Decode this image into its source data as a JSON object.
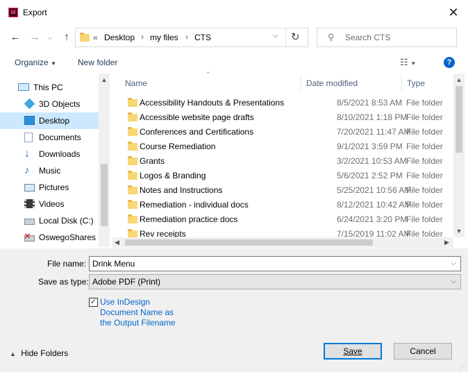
{
  "window": {
    "title": "Export",
    "app_icon_text": "Id"
  },
  "address": {
    "overflow": "«",
    "crumbs": [
      "Desktop",
      "my files",
      "CTS"
    ],
    "separator": "›"
  },
  "search": {
    "placeholder": "Search CTS"
  },
  "toolbar": {
    "organize": "Organize",
    "new_folder": "New folder",
    "help": "?"
  },
  "nav": [
    {
      "label": "This PC",
      "icon": "this-pc-icon"
    },
    {
      "label": "3D Objects",
      "icon": "3d-objects-icon"
    },
    {
      "label": "Desktop",
      "icon": "desktop-icon",
      "selected": true
    },
    {
      "label": "Documents",
      "icon": "documents-icon"
    },
    {
      "label": "Downloads",
      "icon": "downloads-icon"
    },
    {
      "label": "Music",
      "icon": "music-icon"
    },
    {
      "label": "Pictures",
      "icon": "pictures-icon"
    },
    {
      "label": "Videos",
      "icon": "videos-icon"
    },
    {
      "label": "Local Disk (C:)",
      "icon": "disk-icon"
    },
    {
      "label": "OswegoShares (",
      "icon": "network-drive-icon"
    }
  ],
  "columns": {
    "name": "Name",
    "date": "Date modified",
    "type": "Type"
  },
  "files": [
    {
      "name": "Accessibility Handouts & Presentations",
      "date": "8/5/2021 8:53 AM",
      "type": "File folder"
    },
    {
      "name": "Accessible website page drafts",
      "date": "8/10/2021 1:18 PM",
      "type": "File folder"
    },
    {
      "name": "Conferences and Certifications",
      "date": "7/20/2021 11:47 AM",
      "type": "File folder"
    },
    {
      "name": "Course Remediation",
      "date": "9/1/2021 3:59 PM",
      "type": "File folder"
    },
    {
      "name": "Grants",
      "date": "3/2/2021 10:53 AM",
      "type": "File folder"
    },
    {
      "name": "Logos & Branding",
      "date": "5/6/2021 2:52 PM",
      "type": "File folder"
    },
    {
      "name": "Notes and Instructions",
      "date": "5/25/2021 10:56 AM",
      "type": "File folder"
    },
    {
      "name": "Remediation - individual docs",
      "date": "8/12/2021 10:42 AM",
      "type": "File folder"
    },
    {
      "name": "Remediation practice docs",
      "date": "6/24/2021 3:20 PM",
      "type": "File folder"
    },
    {
      "name": "Rev receipts",
      "date": "7/15/2019 11:02 AM",
      "type": "File folder"
    }
  ],
  "form": {
    "file_name_label": "File name:",
    "file_name_value": "Drink Menu",
    "save_type_label": "Save as type:",
    "save_type_value": "Adobe PDF (Print)",
    "checkbox_checked": true,
    "checkbox_lines": [
      "Use InDesign",
      "Document Name as",
      "the Output Filename"
    ],
    "hide_folders": "Hide Folders",
    "save": "Save",
    "cancel": "Cancel"
  },
  "colors": {
    "accent": "#0078d7",
    "link": "#0066cc",
    "selection": "#cce8ff",
    "folder": "#f8d775"
  }
}
